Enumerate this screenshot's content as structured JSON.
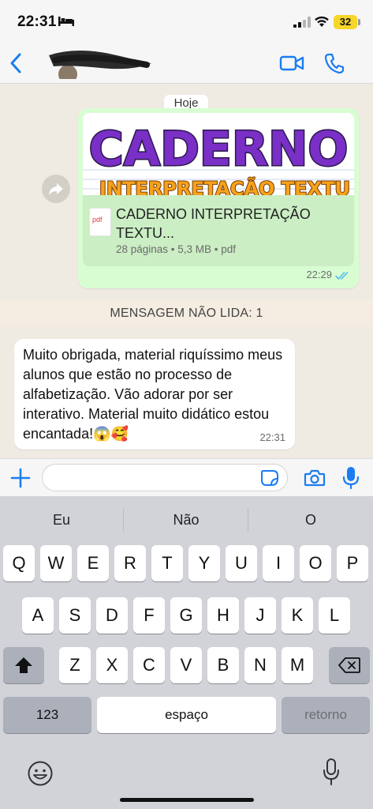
{
  "status_bar": {
    "time": "22:31",
    "battery": "32"
  },
  "chat": {
    "date_label": "Hoje",
    "outgoing": {
      "thumb_title": "CADERNO",
      "thumb_subtitle": "INTERPRETAÇÃO TEXTU",
      "pdf_label": "pdf",
      "file_name": "CADERNO INTERPRETAÇÃO TEXTU...",
      "file_meta": "28 páginas • 5,3 MB • pdf",
      "time": "22:29",
      "read": true
    },
    "unread_banner": "MENSAGEM NÃO LIDA: 1",
    "incoming": {
      "text": "Muito obrigada, material riquíssimo meus alunos que estão no processo de alfabetização. Vão adorar por ser interativo. Material muito didático estou encantada!😱🥰",
      "time": "22:31"
    }
  },
  "composer": {
    "placeholder": ""
  },
  "keyboard": {
    "suggestions": [
      "Eu",
      "Não",
      "O"
    ],
    "row1": [
      "Q",
      "W",
      "E",
      "R",
      "T",
      "Y",
      "U",
      "I",
      "O",
      "P"
    ],
    "row2": [
      "A",
      "S",
      "D",
      "F",
      "G",
      "H",
      "J",
      "K",
      "L"
    ],
    "row3": [
      "Z",
      "X",
      "C",
      "V",
      "B",
      "N",
      "M"
    ],
    "numbers_key": "123",
    "space_key": "espaço",
    "return_key": "retorno"
  },
  "colors": {
    "accent": "#1a7df2",
    "outgoing_bubble": "#d9fdd3",
    "read_ticks": "#53bdeb"
  }
}
